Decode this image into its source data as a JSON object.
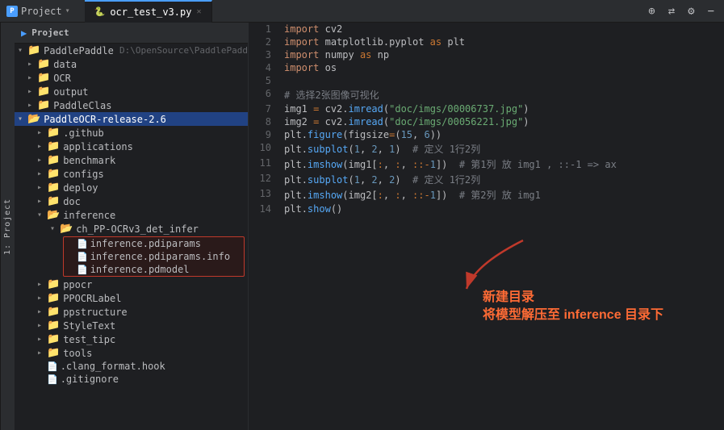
{
  "titlebar": {
    "project_label": "Project",
    "dropdown_arrow": "▾",
    "actions": [
      "+",
      "⇄",
      "⚙",
      "−"
    ],
    "tab_name": "ocr_test_v3.py",
    "tab_icon": "🐍"
  },
  "sidebar_vertical_label": "1: Project",
  "file_tree": {
    "root_label": "PaddlePaddle",
    "root_path": "D:\\OpenSource\\PaddlePaddd",
    "items": [
      {
        "id": "data",
        "label": "data",
        "type": "folder",
        "level": 1,
        "expanded": false
      },
      {
        "id": "OCR",
        "label": "OCR",
        "type": "folder",
        "level": 1,
        "expanded": false
      },
      {
        "id": "output",
        "label": "output",
        "type": "folder",
        "level": 1,
        "expanded": false
      },
      {
        "id": "PaddleClas",
        "label": "PaddleClas",
        "type": "folder",
        "level": 1,
        "expanded": false
      },
      {
        "id": "PaddleOCR",
        "label": "PaddleOCR-release-2.6",
        "type": "folder",
        "level": 1,
        "expanded": true,
        "selected": true
      },
      {
        "id": "github",
        "label": ".github",
        "type": "folder",
        "level": 2,
        "expanded": false
      },
      {
        "id": "applications",
        "label": "applications",
        "type": "folder",
        "level": 2,
        "expanded": false
      },
      {
        "id": "benchmark",
        "label": "benchmark",
        "type": "folder",
        "level": 2,
        "expanded": false
      },
      {
        "id": "configs",
        "label": "configs",
        "type": "folder",
        "level": 2,
        "expanded": false
      },
      {
        "id": "deploy",
        "label": "deploy",
        "type": "folder",
        "level": 2,
        "expanded": false
      },
      {
        "id": "doc",
        "label": "doc",
        "type": "folder",
        "level": 2,
        "expanded": false
      },
      {
        "id": "inference",
        "label": "inference",
        "type": "folder",
        "level": 2,
        "expanded": true
      },
      {
        "id": "ch_PP",
        "label": "ch_PP-OCRv3_det_infer",
        "type": "folder",
        "level": 3,
        "expanded": true
      },
      {
        "id": "pdiparams",
        "label": "inference.pdiparams",
        "type": "params",
        "level": 4,
        "highlighted": true
      },
      {
        "id": "pdiparams_info",
        "label": "inference.pdiparams.info",
        "type": "params_info",
        "level": 4,
        "highlighted": true
      },
      {
        "id": "pdmodel",
        "label": "inference.pdmodel",
        "type": "model",
        "level": 4,
        "highlighted": true
      },
      {
        "id": "ppocr",
        "label": "ppocr",
        "type": "folder",
        "level": 2,
        "expanded": false
      },
      {
        "id": "PPOCRLabel",
        "label": "PPOCRLabel",
        "type": "folder",
        "level": 2,
        "expanded": false
      },
      {
        "id": "ppstructure",
        "label": "ppstructure",
        "type": "folder",
        "level": 2,
        "expanded": false
      },
      {
        "id": "StyleText",
        "label": "StyleText",
        "type": "folder",
        "level": 2,
        "expanded": false
      },
      {
        "id": "test_tipc",
        "label": "test_tipc",
        "type": "folder",
        "level": 2,
        "expanded": false
      },
      {
        "id": "tools",
        "label": "tools",
        "type": "folder",
        "level": 2,
        "expanded": false
      },
      {
        "id": "clang",
        "label": ".clang_format.hook",
        "type": "file",
        "level": 2
      },
      {
        "id": "gitignore",
        "label": ".gitignore",
        "type": "file",
        "level": 2
      }
    ]
  },
  "code_lines": [
    {
      "num": 1,
      "content": "import cv2"
    },
    {
      "num": 2,
      "content": "import matplotlib.pyplot as plt"
    },
    {
      "num": 3,
      "content": "import numpy as np"
    },
    {
      "num": 4,
      "content": "import os"
    },
    {
      "num": 5,
      "content": ""
    },
    {
      "num": 6,
      "content": "# 选择2张图像可视化"
    },
    {
      "num": 7,
      "content": "img1 = cv2.imread(\"doc/imgs/00006737.jpg\")"
    },
    {
      "num": 8,
      "content": "img2 = cv2.imread(\"doc/imgs/00056221.jpg\")"
    },
    {
      "num": 9,
      "content": "plt.figure(figsize=(15, 6))"
    },
    {
      "num": 10,
      "content": "plt.subplot(1, 2, 1)  # 定义 1行2列"
    },
    {
      "num": 11,
      "content": "plt.imshow(img1[:, :, ::-1])  # 第1列 放 img1 , ::-1 => ax"
    },
    {
      "num": 12,
      "content": "plt.subplot(1, 2, 2)  # 定义 1行2列"
    },
    {
      "num": 13,
      "content": "plt.imshow(img2[:, :, ::-1])  # 第2列 放 img1"
    },
    {
      "num": 14,
      "content": "plt.show()"
    }
  ],
  "annotation": {
    "line1": "新建目录",
    "line2": "将模型解压至 inference 目录下"
  }
}
